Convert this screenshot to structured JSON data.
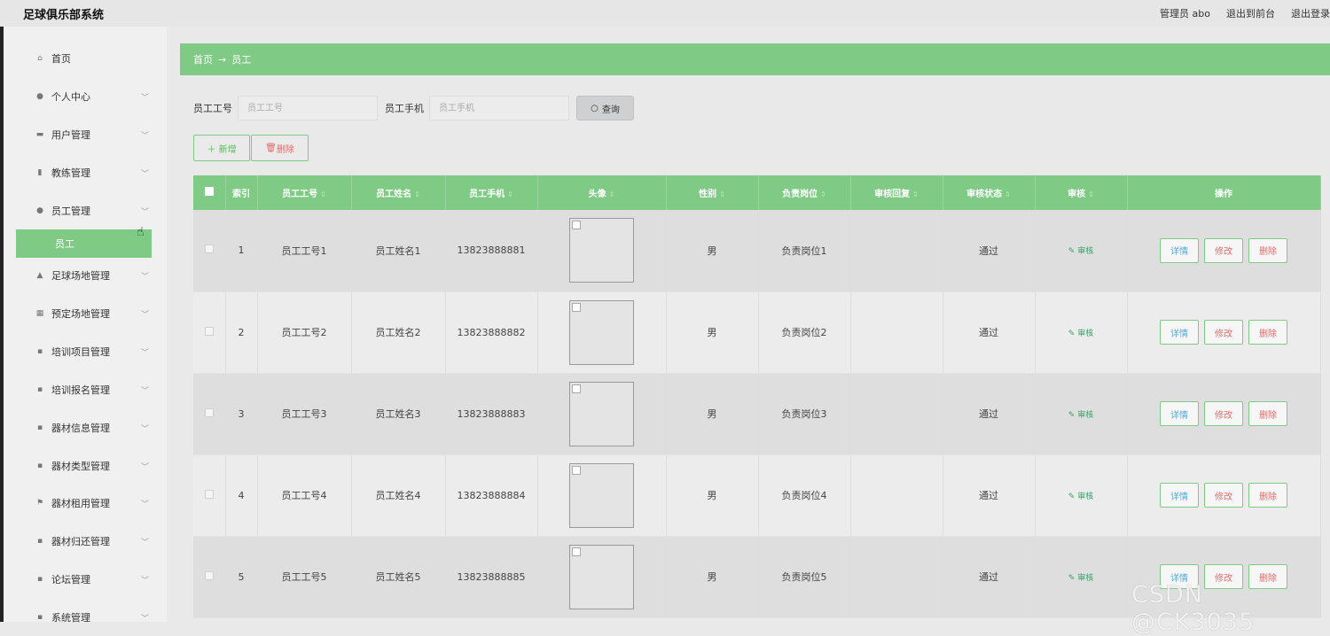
{
  "app": {
    "title": "足球俱乐部系统"
  },
  "top_links": {
    "user": "管理员 abo",
    "front": "退出到前台",
    "logout": "退出登录"
  },
  "sidebar": {
    "items": [
      {
        "label": "首页",
        "icon": "home-icon",
        "glyph": "⌂",
        "chevron": false
      },
      {
        "label": "个人中心",
        "icon": "user-icon",
        "glyph": "●",
        "chevron": true
      },
      {
        "label": "用户管理",
        "icon": "users-icon",
        "glyph": "▬",
        "chevron": true
      },
      {
        "label": "教练管理",
        "icon": "coach-icon",
        "glyph": "▮",
        "chevron": true
      },
      {
        "label": "员工管理",
        "icon": "staff-icon",
        "glyph": "●",
        "chevron": true
      },
      {
        "label": "足球场地管理",
        "icon": "field-icon",
        "glyph": "▲",
        "chevron": true
      },
      {
        "label": "预定场地管理",
        "icon": "grid-icon",
        "glyph": "▦",
        "chevron": true
      },
      {
        "label": "培训项目管理",
        "icon": "grid-icon",
        "glyph": "▪",
        "chevron": true
      },
      {
        "label": "培训报名管理",
        "icon": "grid-icon",
        "glyph": "▪",
        "chevron": true
      },
      {
        "label": "器材信息管理",
        "icon": "grid-icon",
        "glyph": "▪",
        "chevron": true
      },
      {
        "label": "器材类型管理",
        "icon": "grid-icon",
        "glyph": "▪",
        "chevron": true
      },
      {
        "label": "器材租用管理",
        "icon": "flag-icon",
        "glyph": "⚑",
        "chevron": true
      },
      {
        "label": "器材归还管理",
        "icon": "grid-icon",
        "glyph": "▪",
        "chevron": true
      },
      {
        "label": "论坛管理",
        "icon": "grid-icon",
        "glyph": "▪",
        "chevron": true
      },
      {
        "label": "系统管理",
        "icon": "grid-icon",
        "glyph": "▪",
        "chevron": true
      }
    ],
    "active_sub": "员工"
  },
  "breadcrumb": {
    "home": "首页",
    "arrow": "→",
    "current": "员工"
  },
  "search": {
    "label_id": "员工工号",
    "placeholder_id": "员工工号",
    "label_phone": "员工手机",
    "placeholder_phone": "员工手机",
    "query_button": "查询"
  },
  "actions": {
    "add": "＋ 新增",
    "delete": "删除"
  },
  "table": {
    "headers": [
      "",
      "索引",
      "员工工号",
      "员工姓名",
      "员工手机",
      "头像",
      "性别",
      "负责岗位",
      "审核回复",
      "审核状态",
      "审核",
      "操作"
    ],
    "rows": [
      {
        "index": "1",
        "staff_id": "员工工号1",
        "name": "员工姓名1",
        "phone": "13823888881",
        "gender": "男",
        "post": "负责岗位1",
        "reply": "",
        "status": "通过",
        "audit": "审核"
      },
      {
        "index": "2",
        "staff_id": "员工工号2",
        "name": "员工姓名2",
        "phone": "13823888882",
        "gender": "男",
        "post": "负责岗位2",
        "reply": "",
        "status": "通过",
        "audit": "审核"
      },
      {
        "index": "3",
        "staff_id": "员工工号3",
        "name": "员工姓名3",
        "phone": "13823888883",
        "gender": "男",
        "post": "负责岗位3",
        "reply": "",
        "status": "通过",
        "audit": "审核"
      },
      {
        "index": "4",
        "staff_id": "员工工号4",
        "name": "员工姓名4",
        "phone": "13823888884",
        "gender": "男",
        "post": "负责岗位4",
        "reply": "",
        "status": "通过",
        "audit": "审核"
      },
      {
        "index": "5",
        "staff_id": "员工工号5",
        "name": "员工姓名5",
        "phone": "13823888885",
        "gender": "男",
        "post": "负责岗位5",
        "reply": "",
        "status": "通过",
        "audit": "审核"
      }
    ],
    "row_ops": {
      "detail": "详情",
      "edit": "修改",
      "delete": "删除"
    }
  },
  "watermark": "CSDN @CK3035"
}
